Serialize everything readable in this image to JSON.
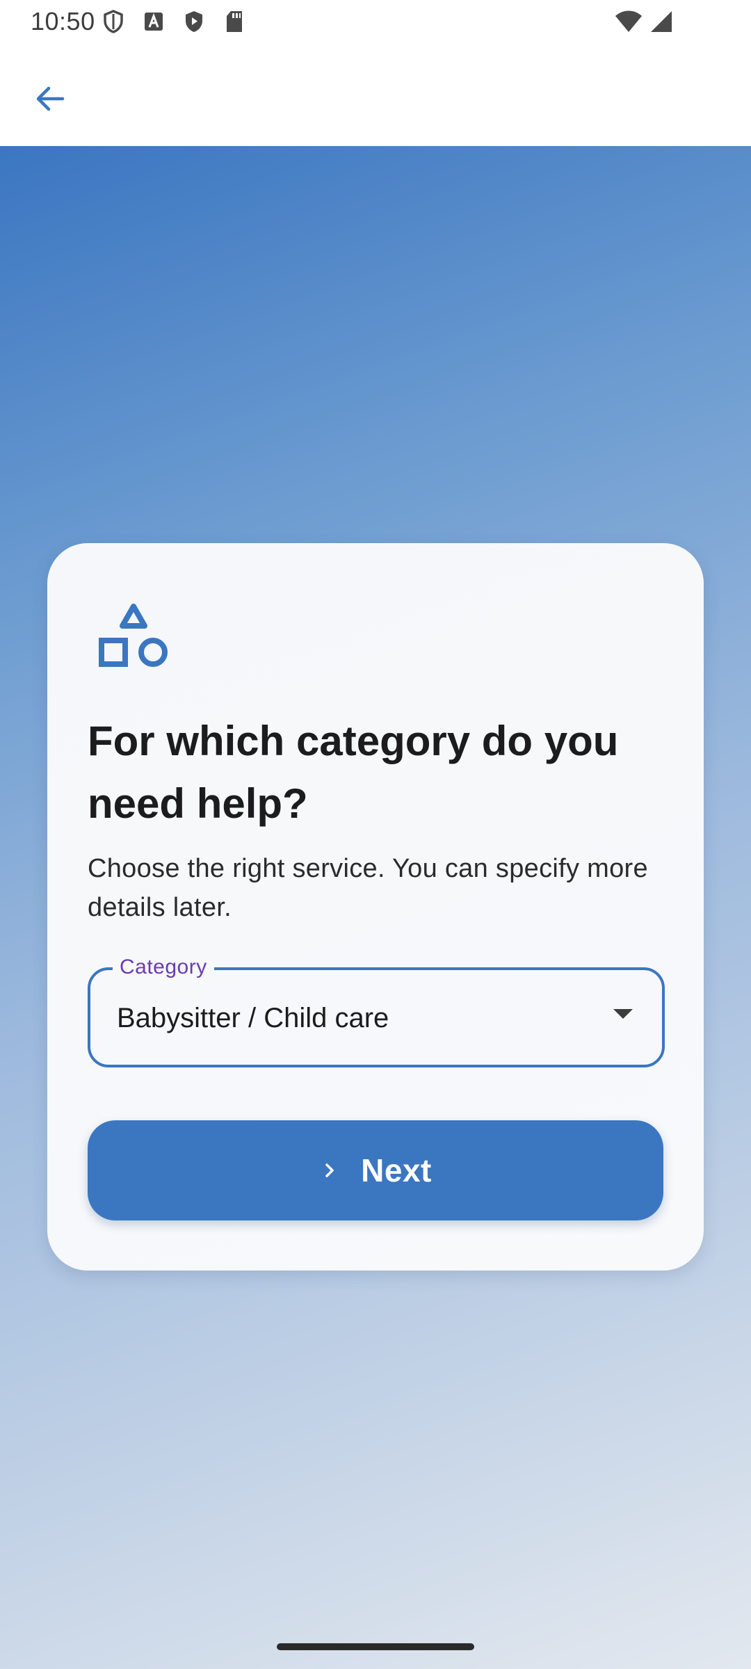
{
  "status_bar": {
    "time": "10:50",
    "icons_left": [
      "shield-outline-icon",
      "text-a-icon",
      "play-shield-icon",
      "sd-card-icon"
    ],
    "icons_right": [
      "wifi-icon",
      "signal-icon"
    ]
  },
  "app_bar": {
    "back_icon": "arrow-back-icon"
  },
  "card": {
    "icon": "category-shapes-icon",
    "title": "For which category do you need help?",
    "subtitle": "Choose the right service. You can specify more details later.",
    "category_field": {
      "label": "Category",
      "value": "Babysitter / Child care"
    },
    "next_button": {
      "label": "Next"
    }
  },
  "colors": {
    "accent": "#3b76c1",
    "field_label": "#6a3ab2",
    "title": "#1c1c1e"
  }
}
